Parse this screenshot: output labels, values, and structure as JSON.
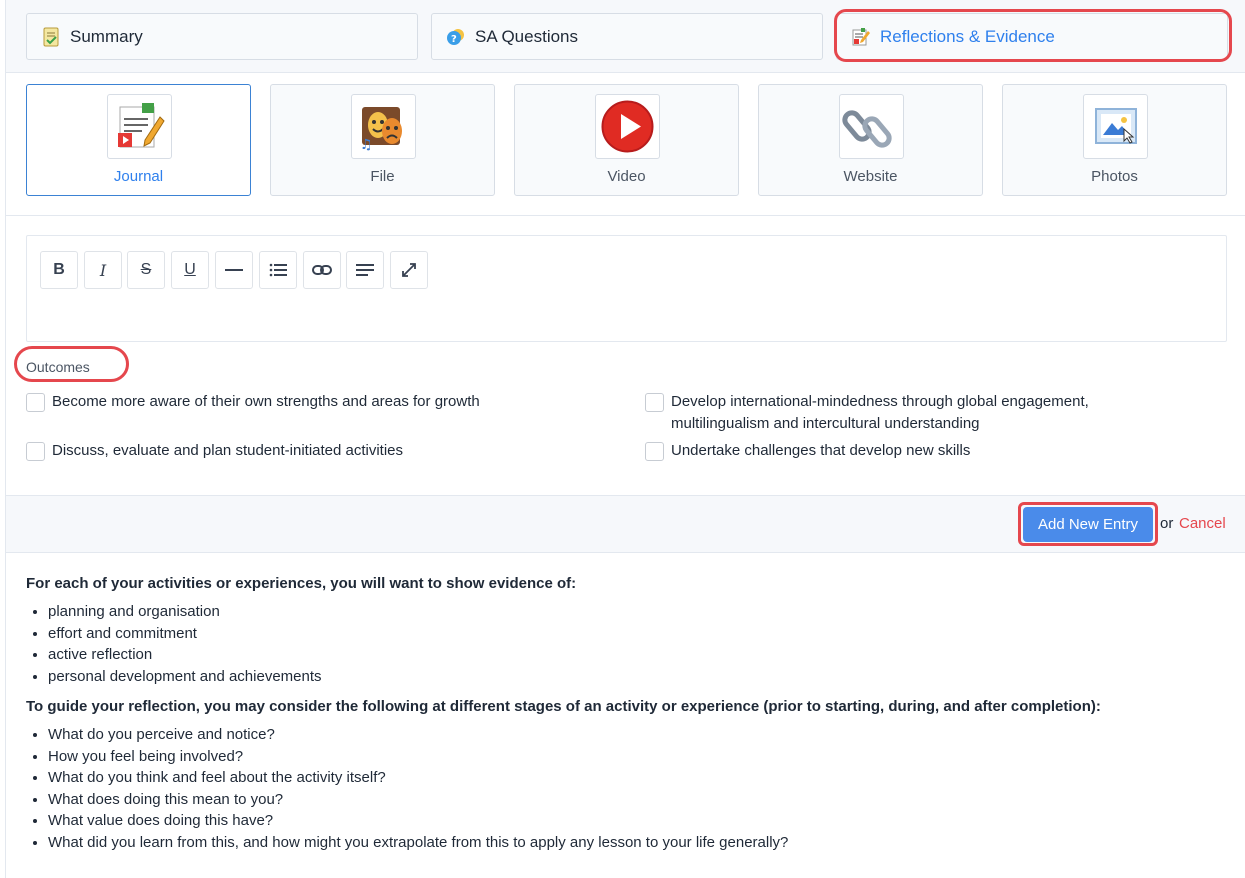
{
  "tabs": [
    {
      "label": "Summary",
      "icon": "summary-notes-icon"
    },
    {
      "label": "SA Questions",
      "icon": "question-bubble-icon"
    },
    {
      "label": "Reflections & Evidence",
      "icon": "reflection-notes-icon",
      "active": true
    }
  ],
  "evidence_types": [
    {
      "label": "Journal",
      "icon": "journal-icon",
      "selected": true
    },
    {
      "label": "File",
      "icon": "theatre-masks-icon"
    },
    {
      "label": "Video",
      "icon": "play-video-icon"
    },
    {
      "label": "Website",
      "icon": "chain-link-icon"
    },
    {
      "label": "Photos",
      "icon": "photo-picture-icon"
    }
  ],
  "toolbar": {
    "bold": "B",
    "italic": "I",
    "strike": "S",
    "underline": "U"
  },
  "outcomes": {
    "title": "Outcomes",
    "items": [
      "Become more aware of their own strengths and areas for growth",
      "Develop international-mindedness through global engagement, multilingualism and intercultural understanding",
      "Discuss, evaluate and plan student-initiated activities",
      "Undertake challenges that develop new skills"
    ]
  },
  "actions": {
    "add_label": "Add New Entry",
    "or_text": "or",
    "cancel_label": "Cancel"
  },
  "guidance": {
    "heading1": "For each of your activities or experiences, you will want to show evidence of:",
    "list1": [
      "planning and organisation",
      "effort and commitment",
      "active reflection",
      "personal development and achievements"
    ],
    "heading2": "To guide your reflection, you may consider the following at different stages of an activity or experience (prior to starting, during, and after completion):",
    "list2": [
      "What do you perceive and notice?",
      "How you feel being involved?",
      "What do you think and feel about the activity itself?",
      "What does doing this mean to you?",
      "What value does doing this have?",
      "What did you learn from this, and how might you extrapolate from this to apply any lesson to your life generally?"
    ]
  },
  "colors": {
    "accent": "#2f80ed",
    "highlight": "#e5474d",
    "button": "#4a8bea"
  }
}
